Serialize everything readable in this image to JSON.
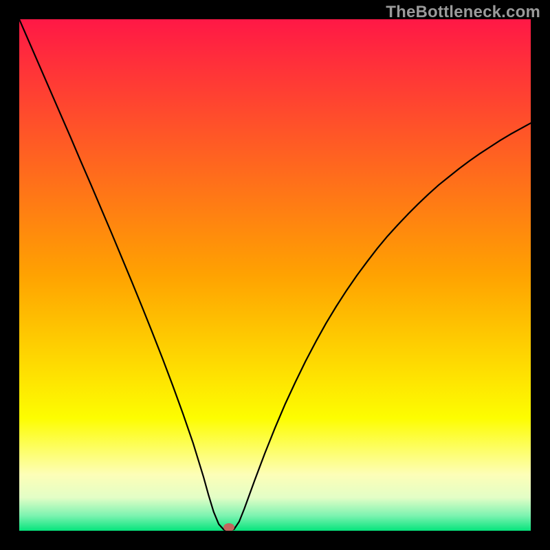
{
  "watermark": "TheBottleneck.com",
  "chart_data": {
    "type": "line",
    "title": "",
    "xlabel": "",
    "ylabel": "",
    "xlim": [
      0,
      100
    ],
    "ylim": [
      0,
      100
    ],
    "minimum_x": 41,
    "marker": {
      "x": 41,
      "y": 0,
      "color": "#c1675e"
    },
    "gradient_stops": [
      {
        "offset": 0.0,
        "color": "#ff1846"
      },
      {
        "offset": 0.5,
        "color": "#ffa201"
      },
      {
        "offset": 0.78,
        "color": "#fdfd01"
      },
      {
        "offset": 0.89,
        "color": "#fdfeb7"
      },
      {
        "offset": 0.935,
        "color": "#e3fec6"
      },
      {
        "offset": 0.97,
        "color": "#7ef3b1"
      },
      {
        "offset": 1.0,
        "color": "#06e47c"
      }
    ],
    "series": [
      {
        "name": "bottleneck-curve",
        "x": [
          0,
          2,
          4,
          6,
          8,
          10,
          12,
          14,
          16,
          18,
          20,
          22,
          24,
          26,
          28,
          30,
          32,
          34,
          36,
          37,
          38,
          39,
          40,
          41,
          42,
          43,
          44,
          46,
          48,
          50,
          52,
          54,
          56,
          58,
          60,
          62,
          64,
          66,
          68,
          70,
          72,
          74,
          76,
          78,
          80,
          82,
          84,
          86,
          88,
          90,
          92,
          94,
          96,
          98,
          100
        ],
        "y": [
          100,
          95.4,
          90.8,
          86.2,
          81.6,
          77.0,
          72.3,
          67.7,
          63.0,
          58.3,
          53.5,
          48.7,
          43.8,
          38.8,
          33.7,
          28.4,
          22.9,
          17.1,
          10.6,
          7.0,
          3.7,
          1.3,
          0.2,
          0.0,
          0.3,
          1.8,
          4.3,
          9.8,
          15.1,
          20.1,
          24.8,
          29.1,
          33.2,
          37.0,
          40.6,
          43.9,
          47.0,
          49.9,
          52.6,
          55.2,
          57.6,
          59.8,
          61.9,
          63.9,
          65.8,
          67.6,
          69.2,
          70.8,
          72.3,
          73.7,
          75.0,
          76.3,
          77.5,
          78.6,
          79.7
        ]
      }
    ]
  }
}
